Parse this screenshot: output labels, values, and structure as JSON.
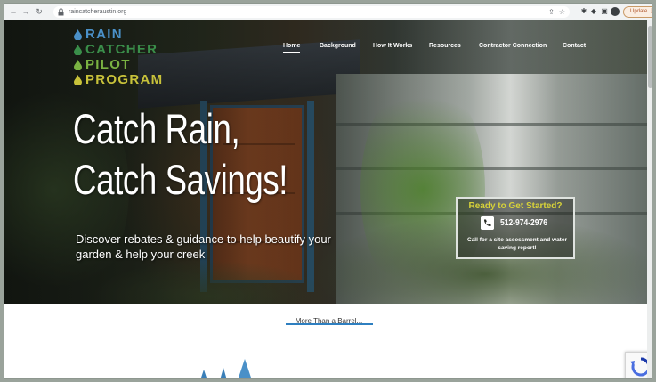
{
  "browser": {
    "url": "raincatcheraustin.org",
    "update_label": "Update"
  },
  "logo": {
    "lines": [
      {
        "text": "RAIN",
        "color": "#4a90c8"
      },
      {
        "text": "CATCHER",
        "color": "#3a8e4a"
      },
      {
        "text": "PILOT",
        "color": "#7ab342"
      },
      {
        "text": "PROGRAM",
        "color": "#c8c23a"
      }
    ]
  },
  "nav": {
    "items": [
      "Home",
      "Background",
      "How It Works",
      "Resources",
      "Contractor Connection",
      "Contact"
    ],
    "active": "Home"
  },
  "hero": {
    "headline_line1": "Catch Rain,",
    "headline_line2": "Catch Savings!",
    "subhead": "Discover rebates & guidance to help beautify your garden & help your creek"
  },
  "cta": {
    "title": "Ready to Get Started?",
    "phone": "512-974-2976",
    "note": "Call for a site assessment and water saving report!"
  },
  "section": {
    "link_text": "More Than a Barrel..."
  },
  "colors": {
    "accent_blue": "#2e7fc0",
    "cta_yellow": "#d7d239"
  }
}
